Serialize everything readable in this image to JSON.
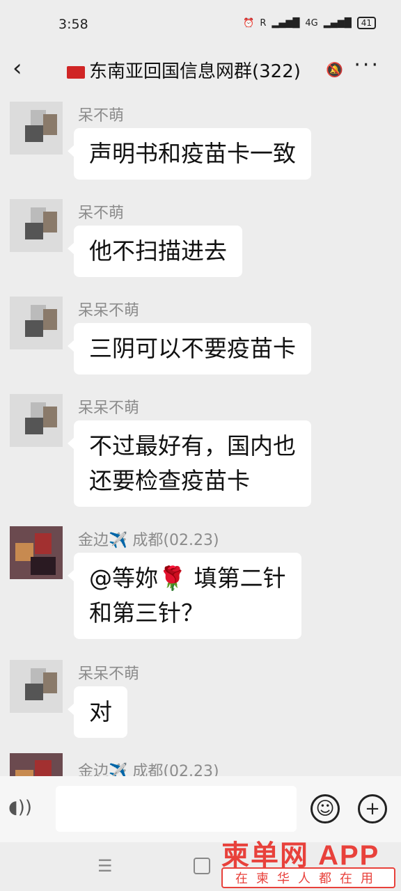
{
  "status": {
    "time": "3:58",
    "signal_text": "R",
    "network": "4G",
    "battery": "41"
  },
  "header": {
    "title": "东南亚回国信息网群(322)"
  },
  "messages": [
    {
      "sender": "呆不萌",
      "text": "声明书和疫苗卡一致"
    },
    {
      "sender": "呆不萌",
      "text": "他不扫描进去"
    },
    {
      "sender": "呆呆不萌",
      "text": "三阴可以不要疫苗卡"
    },
    {
      "sender": "呆呆不萌",
      "line1": "不过最好有，国内也",
      "line2": "还要检查疫苗卡"
    },
    {
      "sender": "金边✈️ 成都(02.23)",
      "line1_a": "@等妳",
      "emoji": "🌹",
      "line1_b": " 填第二针",
      "line2": "和第三针？"
    },
    {
      "sender": "呆呆不萌",
      "text": "对"
    },
    {
      "sender": "金边✈️ 成都(02.23)"
    }
  ],
  "input": {
    "value": ""
  },
  "watermark": {
    "title": "柬单网 APP",
    "subtitle": "在柬华人都在用"
  }
}
